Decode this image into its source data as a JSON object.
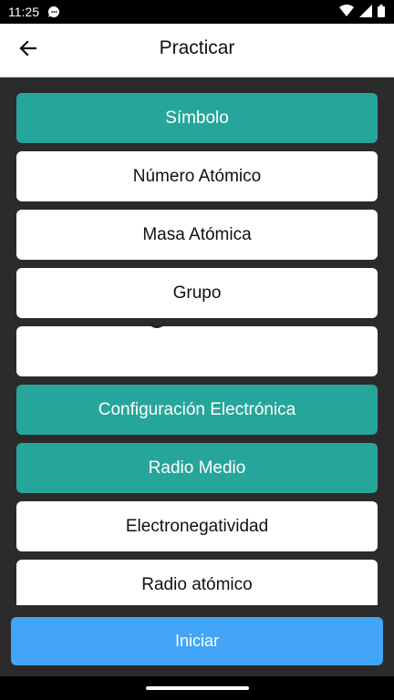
{
  "status": {
    "time": "11:25"
  },
  "appbar": {
    "title": "Practicar"
  },
  "options": [
    {
      "label": "Símbolo",
      "selected": true
    },
    {
      "label": "Número Atómico",
      "selected": false
    },
    {
      "label": "Masa Atómica",
      "selected": false
    },
    {
      "label": "Grupo",
      "selected": false
    },
    {
      "label": "",
      "selected": false
    },
    {
      "label": "Configuración Electrónica",
      "selected": true
    },
    {
      "label": "Radio Medio",
      "selected": true
    },
    {
      "label": "Electronegatividad",
      "selected": false
    },
    {
      "label": "Radio atómico",
      "selected": false
    }
  ],
  "start_button": {
    "label": "Iniciar"
  },
  "colors": {
    "selected": "#26a69a",
    "unselected": "#ffffff",
    "start": "#42a5f5"
  },
  "icons": {
    "back": "arrow-back-icon",
    "status": [
      "chat-icon",
      "wifi-icon",
      "signal-icon",
      "battery-icon"
    ]
  }
}
